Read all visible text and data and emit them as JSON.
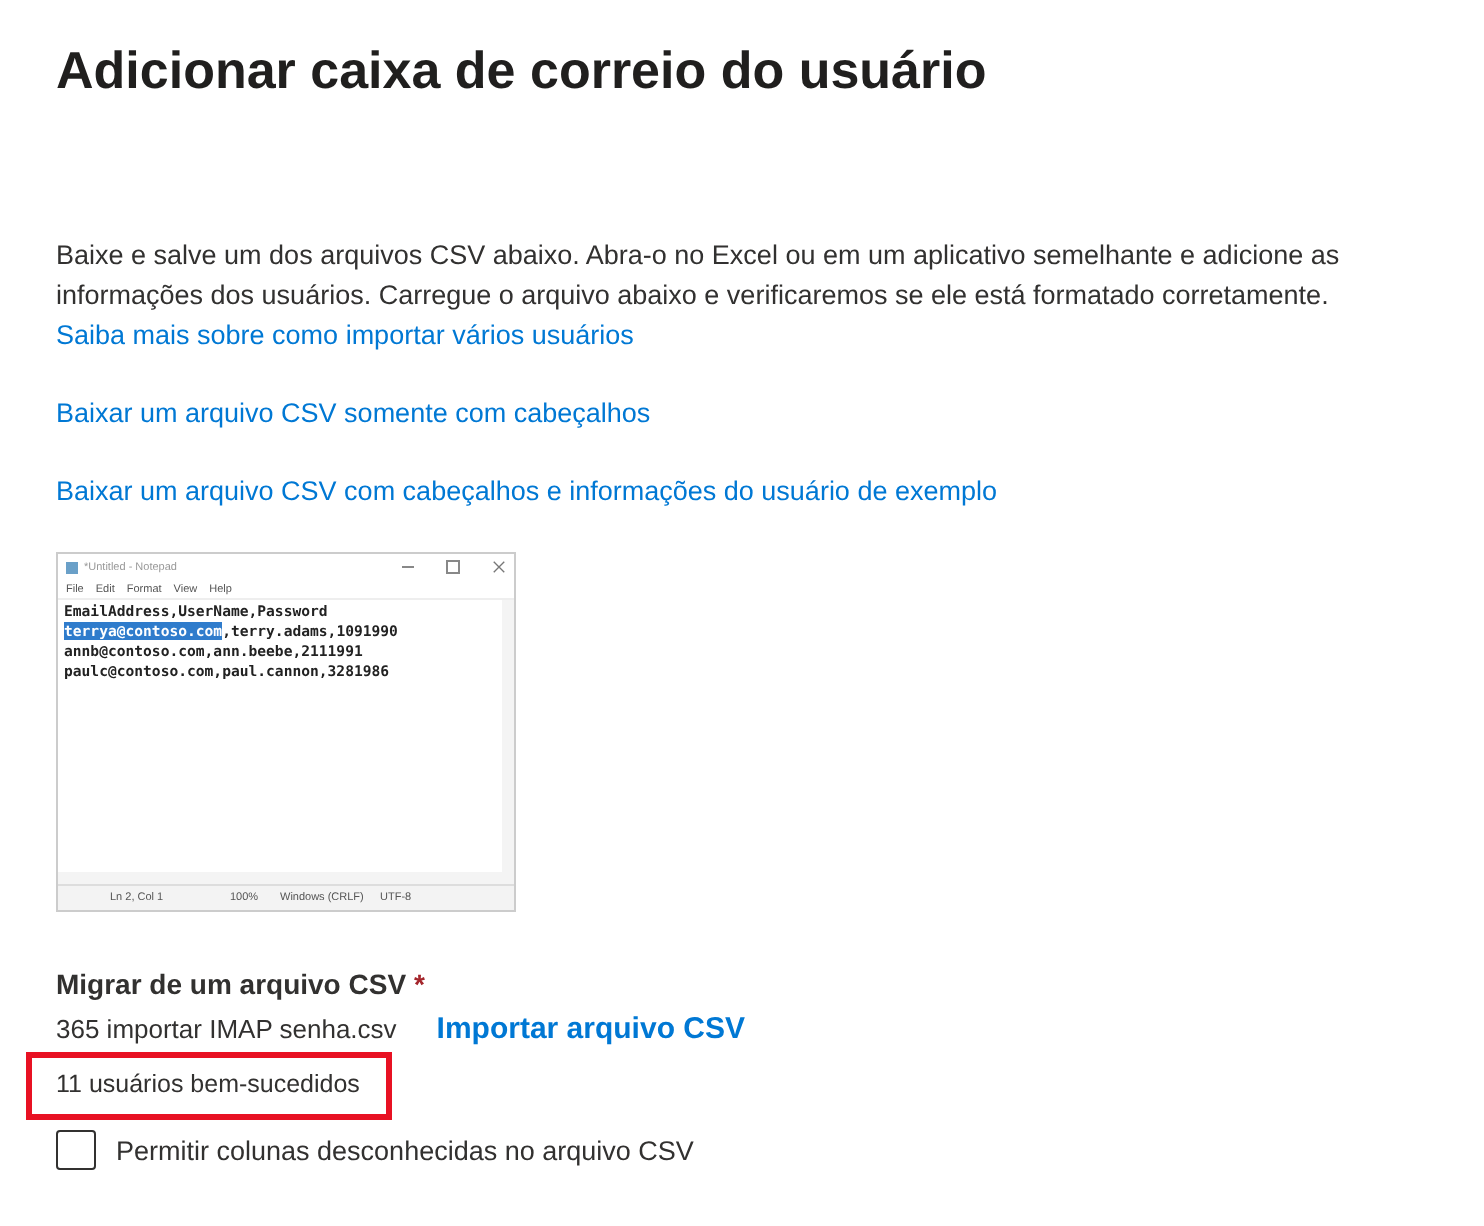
{
  "title": "Adicionar caixa de correio do usuário",
  "intro": "Baixe e salve um dos arquivos CSV abaixo. Abra-o no Excel ou em um aplicativo semelhante e adicione as informações dos usuários. Carregue o arquivo abaixo e verificaremos se ele está formatado corretamente.",
  "links": [
    "Saiba mais sobre como importar vários usuários",
    "Baixar um arquivo CSV somente com cabeçalhos",
    "Baixar um arquivo CSV com cabeçalhos e informações do usuário de exemplo"
  ],
  "notepad": {
    "title": "*Untitled - Notepad",
    "menu": [
      "File",
      "Edit",
      "Format",
      "View",
      "Help"
    ],
    "lines": [
      {
        "text": "EmailAddress,UserName,Password"
      },
      {
        "selected": "terrya@contoso.com",
        "text": ",terry.adams,1091990"
      },
      {
        "text": "annb@contoso.com,ann.beebe,2111991"
      },
      {
        "text": "paulc@contoso.com,paul.cannon,3281986"
      }
    ],
    "status": [
      "Ln 2, Col 1",
      "100%",
      "Windows (CRLF)",
      "UTF-8"
    ]
  },
  "upload": {
    "label": "Migrar de um arquivo CSV",
    "required_mark": "*",
    "file_name": "365 importar IMAP senha.csv",
    "button": "Importar arquivo CSV",
    "result": "11 usuários bem-sucedidos",
    "highlighted": true
  },
  "checkbox": {
    "label": "Permitir colunas desconhecidas no arquivo CSV",
    "checked": false
  }
}
